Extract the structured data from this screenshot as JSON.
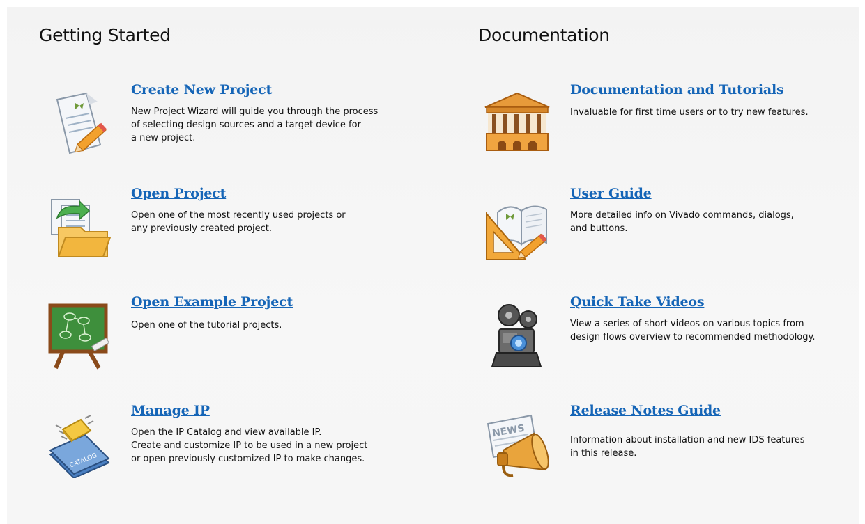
{
  "getting_started": {
    "title": "Getting Started",
    "items": [
      {
        "label": "Create New Project",
        "icon": "create-project-icon",
        "description": [
          "New Project Wizard will guide you through the process",
          "of selecting design sources and a target device for",
          "a new project."
        ]
      },
      {
        "label": "Open Project",
        "icon": "open-project-icon",
        "description": [
          "Open one of the most recently used projects or",
          "any previously created project."
        ]
      },
      {
        "label": "Open Example Project",
        "icon": "example-project-icon",
        "description": [
          "Open one of the tutorial projects."
        ]
      },
      {
        "label": "Manage IP",
        "icon": "ip-catalog-icon",
        "icon_text": "CATALOG",
        "description": [
          "Open the IP Catalog and view available IP.",
          "Create and customize IP to be used in a new project",
          "or open previously customized IP to make changes."
        ]
      }
    ]
  },
  "documentation": {
    "title": "Documentation",
    "items": [
      {
        "label": "Documentation and Tutorials",
        "icon": "library-building-icon",
        "description": [
          "Invaluable for first time users or to try new features."
        ]
      },
      {
        "label": "User Guide",
        "icon": "user-guide-icon",
        "description": [
          "More detailed info on Vivado commands, dialogs,",
          "and buttons."
        ]
      },
      {
        "label": "Quick Take Videos",
        "icon": "film-projector-icon",
        "description": [
          "View a series of short videos on various topics from",
          "design flows overview to recommended methodology."
        ]
      },
      {
        "label": "Release Notes Guide",
        "icon": "news-megaphone-icon",
        "icon_text": "NEWS",
        "description": [
          "Information about installation and new IDS features",
          "in this release."
        ]
      }
    ]
  },
  "colors": {
    "link": "#1565b7",
    "text": "#111111",
    "panel_background": "#f5f5f5"
  }
}
